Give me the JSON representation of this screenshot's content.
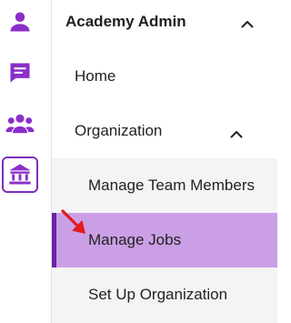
{
  "rail": {
    "items": [
      {
        "icon": "person-icon",
        "active": false
      },
      {
        "icon": "chat-icon",
        "active": false
      },
      {
        "icon": "group-icon",
        "active": false
      },
      {
        "icon": "institution-icon",
        "active": true
      }
    ]
  },
  "nav": {
    "header": {
      "label": "Academy Admin",
      "expanded": true
    },
    "items": [
      {
        "label": "Home"
      },
      {
        "label": "Organization",
        "expanded": true
      }
    ],
    "sub_items": [
      {
        "label": "Manage Team Members"
      },
      {
        "label": "Manage Jobs",
        "selected": true
      },
      {
        "label": "Set Up Organization"
      }
    ]
  },
  "colors": {
    "accent": "#7b2fbf",
    "selected_bg": "#cb9fe6",
    "selected_border": "#6a23a6",
    "sub_bg": "#f4f4f4",
    "pointer_arrow": "#e01b1b"
  }
}
